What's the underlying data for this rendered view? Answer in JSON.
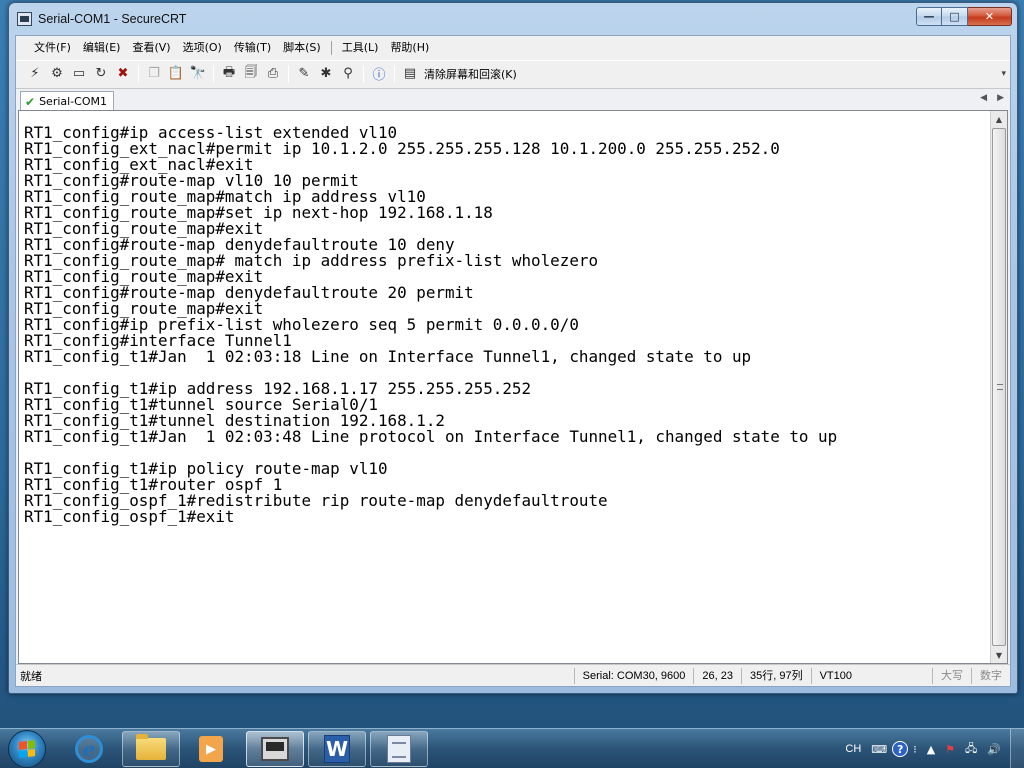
{
  "window": {
    "title": "Serial-COM1 - SecureCRT",
    "minimize_glyph": "—",
    "maximize_glyph": "□",
    "close_glyph": "✕"
  },
  "menu": {
    "file": "文件(F)",
    "edit": "编辑(E)",
    "view": "查看(V)",
    "options": "选项(O)",
    "transfer": "传输(T)",
    "script": "脚本(S)",
    "tools": "工具(L)",
    "help": "帮助(H)"
  },
  "toolbar": {
    "clear_label": "清除屏幕和回滚(K)",
    "icons": [
      "connect-icon",
      "quick-connect-icon",
      "connect-tab-icon",
      "reconnect-icon",
      "disconnect-icon",
      "copy-icon",
      "paste-icon",
      "find-icon",
      "print-icon",
      "print-screen-icon",
      "print-selection-icon",
      "session-options-icon",
      "global-options-icon",
      "keymap-icon",
      "help-icon",
      "clear-screen-icon"
    ]
  },
  "tabs": [
    {
      "label": "Serial-COM1",
      "active": true
    }
  ],
  "terminal": {
    "lines": [
      "RT1_config#ip access-list extended vl10",
      "RT1_config_ext_nacl#permit ip 10.1.2.0 255.255.255.128 10.1.200.0 255.255.252.0",
      "RT1_config_ext_nacl#exit",
      "RT1_config#route-map vl10 10 permit",
      "RT1_config_route_map#match ip address vl10",
      "RT1_config_route_map#set ip next-hop 192.168.1.18",
      "RT1_config_route_map#exit",
      "RT1_config#route-map denydefaultroute 10 deny",
      "RT1_config_route_map# match ip address prefix-list wholezero",
      "RT1_config_route_map#exit",
      "RT1_config#route-map denydefaultroute 20 permit",
      "RT1_config_route_map#exit",
      "RT1_config#ip prefix-list wholezero seq 5 permit 0.0.0.0/0",
      "RT1_config#interface Tunnel1",
      "RT1_config_t1#Jan  1 02:03:18 Line on Interface Tunnel1, changed state to up",
      "",
      "RT1_config_t1#ip address 192.168.1.17 255.255.255.252",
      "RT1_config_t1#tunnel source Serial0/1",
      "RT1_config_t1#tunnel destination 192.168.1.2",
      "RT1_config_t1#Jan  1 02:03:48 Line protocol on Interface Tunnel1, changed state to up",
      "",
      "RT1_config_t1#ip policy route-map vl10",
      "RT1_config_t1#router ospf 1",
      "RT1_config_ospf_1#redistribute rip route-map denydefaultroute",
      "RT1_config_ospf_1#exit"
    ]
  },
  "statusbar": {
    "ready": "就绪",
    "connection": "Serial: COM30, 9600",
    "cursor": "26,  23",
    "size": "35行, 97列",
    "emulation": "VT100",
    "caps": "大写",
    "num": "数字"
  },
  "taskbar": {
    "tray_language": "CH",
    "tray_help": "?"
  },
  "colors": {
    "terminal_bg": "#ffffff",
    "terminal_fg": "#000000",
    "window_frame": "#a9c6e6",
    "close_button": "#c33c1c",
    "taskbar": "#2b5478"
  }
}
